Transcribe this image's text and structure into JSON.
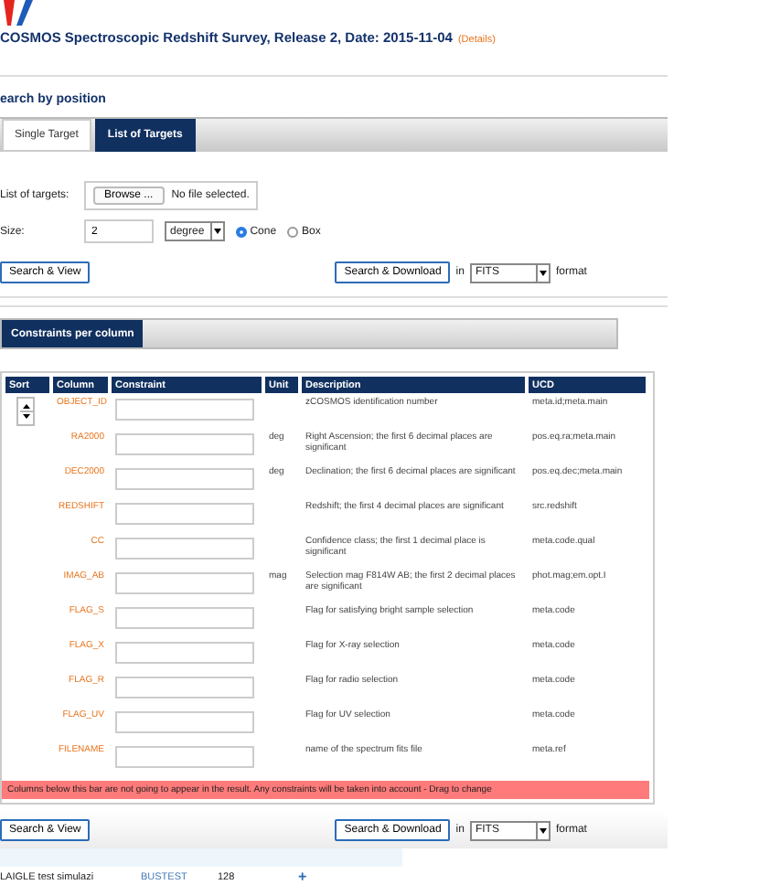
{
  "header": {
    "title": "COSMOS Spectroscopic Redshift Survey, Release 2, Date: 2015-11-04",
    "details_link": "(Details)"
  },
  "search": {
    "heading": "earch by position",
    "tabs": [
      {
        "label": "Single Target",
        "selected": false
      },
      {
        "label": "List of Targets",
        "selected": true
      }
    ],
    "targets_label": "List of targets:",
    "browse_button": "Browse ...",
    "file_status": "No file selected.",
    "size_label": "Size:",
    "size_value": "2",
    "unit_select": "degree",
    "shapes": [
      {
        "label": "Cone",
        "selected": true
      },
      {
        "label": "Box",
        "selected": false
      }
    ]
  },
  "actions": {
    "view_button": "Search & View",
    "download_button": "Search & Download",
    "in_label": "in",
    "format_select": "FITS",
    "format_label": "format"
  },
  "constraints": {
    "title": "Constraints per column",
    "columns": [
      "Sort",
      "Column",
      "Constraint",
      "Unit",
      "Description",
      "UCD"
    ],
    "rows": [
      {
        "name": "OBJECT_ID",
        "unit": "",
        "description": "zCOSMOS identification number",
        "ucd": "meta.id;meta.main",
        "sort_arrows": true
      },
      {
        "name": "RA2000",
        "unit": "deg",
        "description": "Right Ascension; the first 6 decimal places are significant",
        "ucd": "pos.eq.ra;meta.main",
        "sort_arrows": false
      },
      {
        "name": "DEC2000",
        "unit": "deg",
        "description": "Declination; the first 6 decimal places are significant",
        "ucd": "pos.eq.dec;meta.main",
        "sort_arrows": false
      },
      {
        "name": "REDSHIFT",
        "unit": "",
        "description": "Redshift; the first 4 decimal places are significant",
        "ucd": "src.redshift",
        "sort_arrows": false
      },
      {
        "name": "CC",
        "unit": "",
        "description": "Confidence class; the first 1 decimal place is significant",
        "ucd": "meta.code.qual",
        "sort_arrows": false
      },
      {
        "name": "IMAG_AB",
        "unit": "mag",
        "description": "Selection mag F814W AB; the first 2 decimal places are significant",
        "ucd": "phot.mag;em.opt.I",
        "sort_arrows": false
      },
      {
        "name": "FLAG_S",
        "unit": "",
        "description": "Flag for satisfying bright sample selection",
        "ucd": "meta.code",
        "sort_arrows": false
      },
      {
        "name": "FLAG_X",
        "unit": "",
        "description": "Flag for X-ray selection",
        "ucd": "meta.code",
        "sort_arrows": false
      },
      {
        "name": "FLAG_R",
        "unit": "",
        "description": "Flag for radio selection",
        "ucd": "meta.code",
        "sort_arrows": false
      },
      {
        "name": "FLAG_UV",
        "unit": "",
        "description": "Flag for UV selection",
        "ucd": "meta.code",
        "sort_arrows": false
      },
      {
        "name": "FILENAME",
        "unit": "",
        "description": "name of the spectrum fits file",
        "ucd": "meta.ref",
        "sort_arrows": false
      }
    ],
    "hidden_bar": "Columns below this bar are not going to appear in the result. Any constraints will be taken into account - Drag to change"
  },
  "bottom_actions": {
    "view_button": "Search & View",
    "download_button": "Search & Download",
    "in_label": "in",
    "format_select": "FITS",
    "format_label": "format"
  },
  "jobs": [
    {
      "name": "LAIGLE test simulazi",
      "table": "BUSTEST",
      "count": "128",
      "add": "+"
    }
  ]
}
